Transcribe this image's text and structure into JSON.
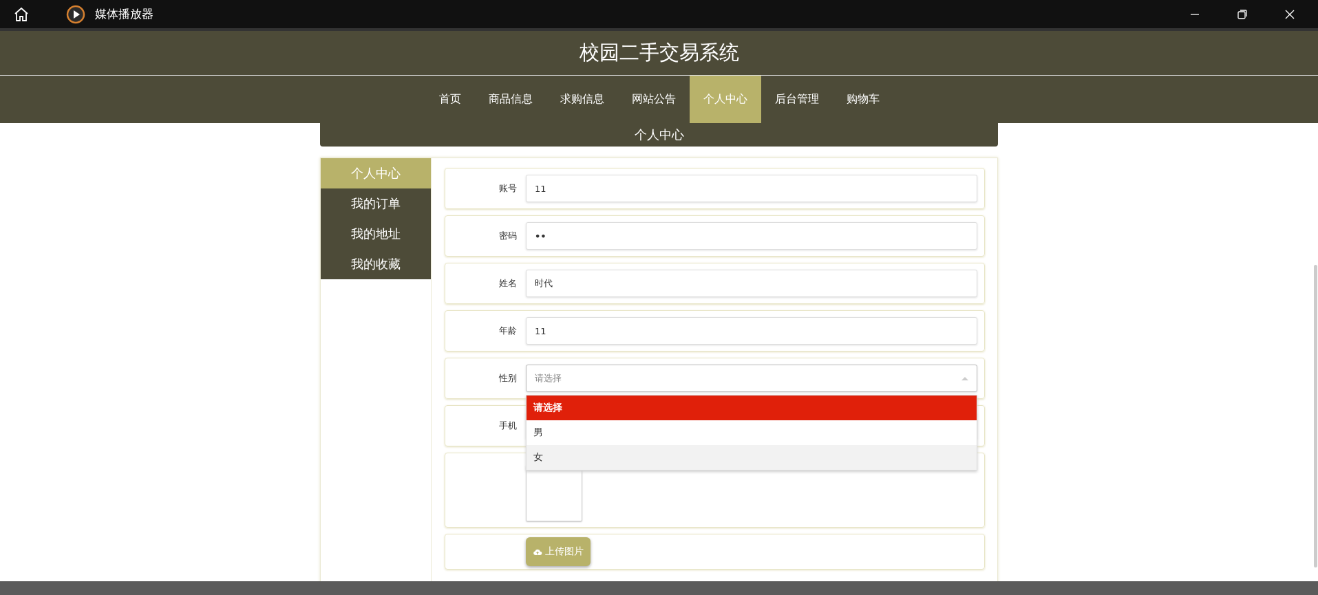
{
  "window": {
    "title": "媒体播放器"
  },
  "site": {
    "title": "校园二手交易系统",
    "nav": [
      {
        "label": "首页",
        "selected": false
      },
      {
        "label": "商品信息",
        "selected": false
      },
      {
        "label": "求购信息",
        "selected": false
      },
      {
        "label": "网站公告",
        "selected": false
      },
      {
        "label": "个人中心",
        "selected": true
      },
      {
        "label": "后台管理",
        "selected": false
      },
      {
        "label": "购物车",
        "selected": false
      }
    ]
  },
  "section_title": "个人中心",
  "sidebar": [
    {
      "label": "个人中心",
      "selected": true
    },
    {
      "label": "我的订单",
      "selected": false
    },
    {
      "label": "我的地址",
      "selected": false
    },
    {
      "label": "我的收藏",
      "selected": false
    }
  ],
  "form": {
    "fields": [
      {
        "kind": "text",
        "label": "账号",
        "value": "11"
      },
      {
        "kind": "password",
        "label": "密码",
        "value": "••"
      },
      {
        "kind": "text",
        "label": "姓名",
        "value": "时代"
      },
      {
        "kind": "text",
        "label": "年龄",
        "value": "11"
      },
      {
        "kind": "select",
        "label": "性别",
        "placeholder": "请选择",
        "expanded": true,
        "options": [
          {
            "label": "请选择",
            "selected": true,
            "hovered": false
          },
          {
            "label": "男",
            "selected": false,
            "hovered": false
          },
          {
            "label": "女",
            "selected": false,
            "hovered": true
          }
        ]
      },
      {
        "kind": "text",
        "label": "手机"
      },
      {
        "kind": "image"
      },
      {
        "kind": "upload",
        "button": "上传图片"
      }
    ]
  }
}
